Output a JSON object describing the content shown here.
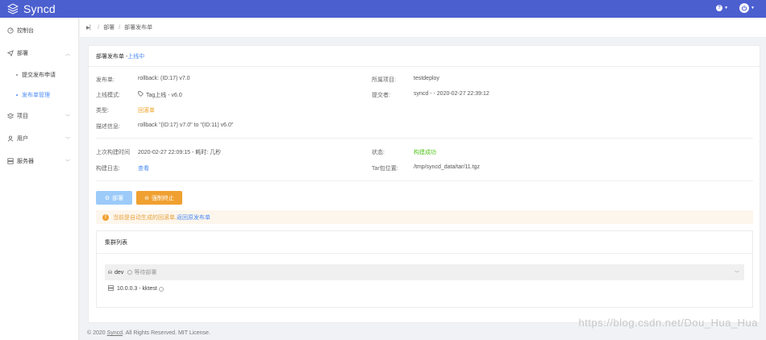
{
  "app": {
    "title": "Syncd"
  },
  "sidebar": {
    "items": [
      {
        "label": "控制台",
        "icon": "dashboard-icon"
      },
      {
        "label": "部署",
        "icon": "send-icon"
      },
      {
        "label": "项目",
        "icon": "layers-icon"
      },
      {
        "label": "用户",
        "icon": "user-icon"
      },
      {
        "label": "服务器",
        "icon": "server-icon"
      }
    ],
    "sub_items": [
      {
        "label": "提交发布申请"
      },
      {
        "label": "发布单管理"
      }
    ]
  },
  "breadcrumb": {
    "items": [
      "部署",
      "部署发布单"
    ]
  },
  "card": {
    "title": "部署发布单 - ",
    "status": "上线中"
  },
  "details": {
    "release_label": "发布单:",
    "release_value": "rollback: (ID:17) v7.0",
    "mode_label": "上线模式:",
    "mode_value": "Tag上线 - v6.0",
    "type_label": "类型:",
    "type_value": "回滚单",
    "desc_label": "描述信息:",
    "desc_value": "rollback \"(ID:17) v7.0\" to \"(ID:11) v6.0\"",
    "project_label": "所属项目:",
    "project_value": "testdeploy",
    "submitter_label": "提交者:",
    "submitter_value": "syncd - - 2020-02-27 22:39:12"
  },
  "build": {
    "last_build_label": "上次构建时间",
    "last_build_value": "2020-02-27 22:09:15 - 耗时: 几秒",
    "log_label": "构建日志:",
    "log_link": "查看",
    "status_label": "状态:",
    "status_value": "构建成功",
    "tar_label": "Tar包位置:",
    "tar_value": "/tmp/syncd_data/tar/11.tgz"
  },
  "actions": {
    "deploy_label": "部署",
    "stop_label": "强制终止"
  },
  "alert": {
    "text": "当前是自动生成的回滚单, ",
    "link": "返回原发布单"
  },
  "cluster": {
    "title": "集群列表",
    "env_name": "dev",
    "env_status": "等待部署",
    "server": "10.0.0.3 - kktest"
  },
  "footer": {
    "prefix": "© 2020 ",
    "link": "Syncd",
    "suffix": ". All Rights Reserved. MIT License."
  },
  "watermark": "https://blog.csdn.net/Dou_Hua_Hua",
  "colors": {
    "header": "#4c5fcf",
    "accent": "#4c8bf5",
    "warning": "#f0a030",
    "success": "#52c41a"
  }
}
